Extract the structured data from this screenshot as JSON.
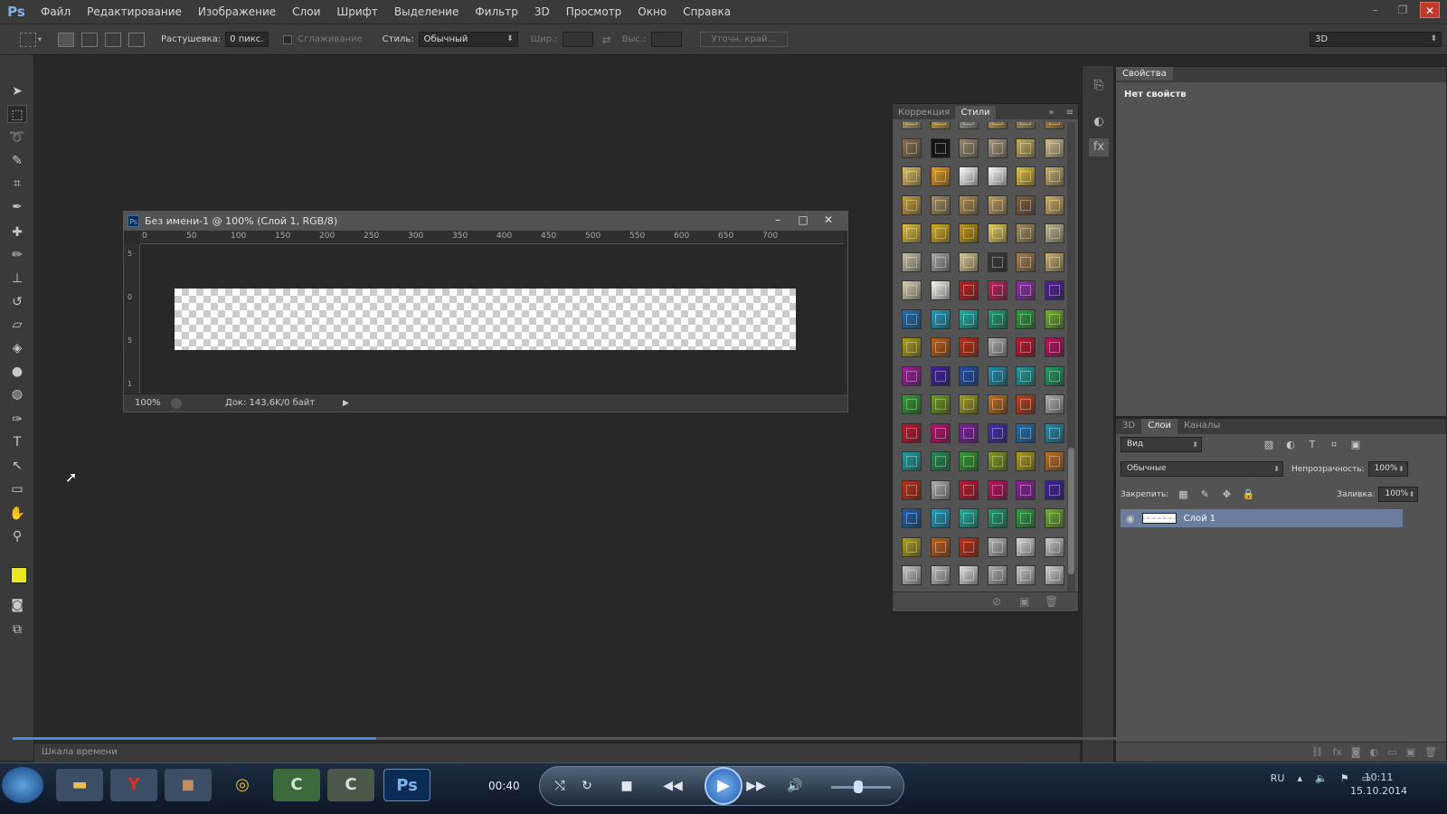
{
  "app": {
    "logo": "Ps"
  },
  "menu": [
    "Файл",
    "Редактирование",
    "Изображение",
    "Слои",
    "Шрифт",
    "Выделение",
    "Фильтр",
    "3D",
    "Просмотр",
    "Окно",
    "Справка"
  ],
  "options": {
    "feather_label": "Растушевка:",
    "feather_value": "0 пикс.",
    "antialias_label": "Сглаживание",
    "style_label": "Стиль:",
    "style_value": "Обычный",
    "width_label": "Шир.:",
    "height_label": "Выс.:",
    "refine_button": "Уточн. край...",
    "workspace_value": "3D"
  },
  "document": {
    "title": "Без имени-1 @ 100% (Слой 1, RGB/8)",
    "zoom": "100%",
    "doc_info": "Док: 143,6K/0 байт",
    "ruler_top": [
      "0",
      "50",
      "100",
      "150",
      "200",
      "250",
      "300",
      "350",
      "400",
      "450",
      "500",
      "550",
      "600",
      "650",
      "700"
    ],
    "ruler_left": [
      "5",
      "0",
      "5",
      "1"
    ]
  },
  "styles_panel": {
    "tab_correction": "Коррекция",
    "tab_styles": "Стили",
    "swatch_rows": [
      [
        "#c8b070",
        "#d8b040",
        "#a8a090",
        "#c8a850",
        "#b8a060",
        "#c09040"
      ],
      [
        "#8a7050",
        "#111111",
        "#9a8a70",
        "#a89880",
        "#c8b060",
        "#d0c090"
      ],
      [
        "#e0c060",
        "#e8a020",
        "#ffffff",
        "#ffffff",
        "#e0c040",
        "#c8b070"
      ],
      [
        "#c8a040",
        "#a89060",
        "#b09050",
        "#c0a060",
        "#806040",
        "#d0b060"
      ],
      [
        "#e0c040",
        "#d8b020",
        "#c89818",
        "#e8d060",
        "#a89060",
        "#c0b890"
      ],
      [
        "#c8c0a8",
        "#a8a8a8",
        "#d8c890",
        "#3a3a3a",
        "#a88050",
        "#c8b070"
      ],
      [
        "#d8d0b0",
        "#f8f8f0",
        "#c02020",
        "#c02060",
        "#9030b0",
        "#5020a0"
      ],
      [
        "#2070b0",
        "#20a0c0",
        "#20b0a8",
        "#20a070",
        "#30a040",
        "#70b030"
      ],
      [
        "#b0a020",
        "#c06018",
        "#c03018",
        "#b0b0b0",
        "#c01830",
        "#c01060"
      ],
      [
        "#a020a0",
        "#4020a0",
        "#2050b0",
        "#2090b0",
        "#20a0a0",
        "#20a060"
      ],
      [
        "#30a030",
        "#70a020",
        "#a0a020",
        "#c07020",
        "#c04020",
        "#b0b0b0"
      ],
      [
        "#c01830",
        "#c01070",
        "#8020a0",
        "#4030b0",
        "#2070b0",
        "#2090b0"
      ],
      [
        "#20a0a0",
        "#209050",
        "#30a030",
        "#80a020",
        "#b0a020",
        "#c07020"
      ],
      [
        "#c03018",
        "#b0b0b0",
        "#c01830",
        "#c01060",
        "#9020a0",
        "#4020a0"
      ],
      [
        "#2060b0",
        "#20a0c0",
        "#20b0a0",
        "#20a070",
        "#30a040",
        "#70b030"
      ],
      [
        "#b0a020",
        "#c06018",
        "#c03018",
        "#b8b8b8",
        "#d8d8d8",
        "#c8c8c8"
      ],
      [
        "#c8c8c8",
        "#c0c0c0",
        "#e0e0e0",
        "#b0b0b0",
        "#c8c8c8",
        "#d0d0d0"
      ]
    ]
  },
  "properties": {
    "tab": "Свойства",
    "empty_text": "Нет свойств"
  },
  "layers": {
    "tabs": [
      "3D",
      "Слои",
      "Каналы"
    ],
    "filter_kind": "Вид",
    "blend_mode": "Обычные",
    "opacity_label": "Непрозрачность:",
    "opacity_value": "100%",
    "lock_label": "Закрепить:",
    "fill_label": "Заливка:",
    "fill_value": "100%",
    "layer_name": "Слой 1"
  },
  "timeline": {
    "label": "Шкала времени",
    "progress": 0.26
  },
  "player": {
    "time": "00:40",
    "volume": 0.45
  },
  "taskbar": {
    "lang": "RU",
    "time": "10:11",
    "date": "15.10.2014"
  }
}
